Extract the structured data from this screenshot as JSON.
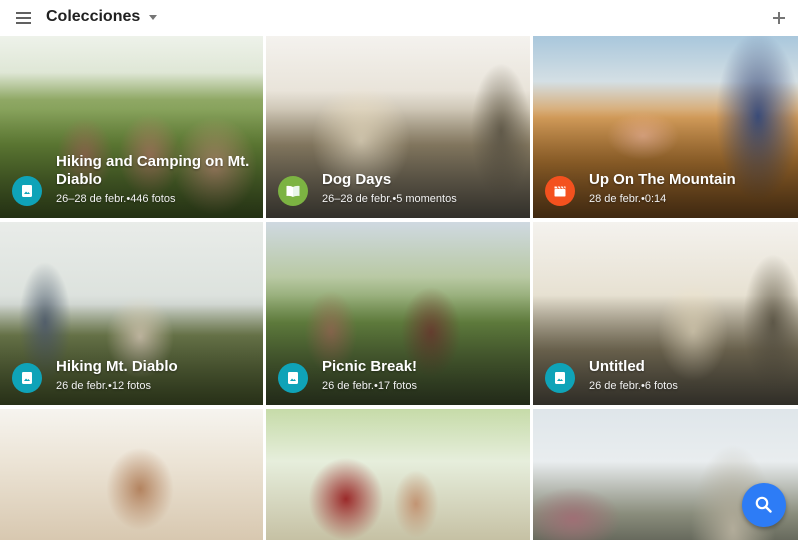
{
  "app_bar": {
    "title": "Colecciones"
  },
  "colors": {
    "photo_badge": "#0fa3b8",
    "story_badge": "#7cb342",
    "movie_badge": "#f4511e",
    "fab": "#2d7cf6"
  },
  "collections": [
    {
      "title": "Hiking and Camping on Mt. Diablo",
      "subtitle": "26–28 de febr.•446 fotos",
      "icon": "photo-album-icon"
    },
    {
      "title": "Dog Days",
      "subtitle": "26–28 de febr.•5 momentos",
      "icon": "story-book-icon"
    },
    {
      "title": "Up On The Mountain",
      "subtitle": "28 de febr.•0:14",
      "icon": "movie-clapper-icon"
    },
    {
      "title": "Hiking Mt. Diablo",
      "subtitle": "26 de febr.•12 fotos",
      "icon": "photo-album-icon"
    },
    {
      "title": "Picnic Break!",
      "subtitle": "26 de febr.•17 fotos",
      "icon": "photo-album-icon"
    },
    {
      "title": "Untitled",
      "subtitle": "26 de febr.•6 fotos",
      "icon": "photo-album-icon"
    }
  ],
  "partial_tiles": [
    {
      "photo": "person-smiling-sunglasses-photo"
    },
    {
      "photo": "hiker-red-striped-shirt-photo"
    },
    {
      "photo": "suspension-bridge-photo"
    }
  ],
  "fab_icon": "search-icon",
  "menu_icon": "hamburger-menu-icon",
  "add_icon": "plus-icon"
}
